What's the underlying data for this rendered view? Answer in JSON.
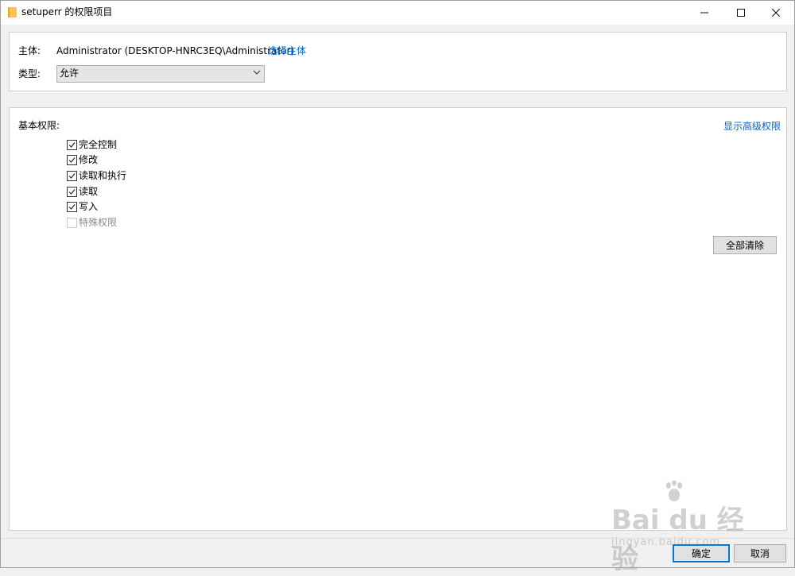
{
  "window": {
    "title": "setuperr 的权限项目",
    "icon": "folder-icon",
    "controls": [
      "minimize-icon",
      "maximize-icon",
      "close-icon"
    ]
  },
  "principal": {
    "label": "主体:",
    "value": "Administrator (DESKTOP-HNRC3EQ\\Administrator)",
    "select_link": "选择主体"
  },
  "type": {
    "label": "类型:",
    "selected": "允许"
  },
  "permissions": {
    "heading": "基本权限:",
    "advanced_link": "显示高级权限",
    "items": [
      {
        "label": "完全控制",
        "checked": true,
        "enabled": true
      },
      {
        "label": "修改",
        "checked": true,
        "enabled": true
      },
      {
        "label": "读取和执行",
        "checked": true,
        "enabled": true
      },
      {
        "label": "读取",
        "checked": true,
        "enabled": true
      },
      {
        "label": "写入",
        "checked": true,
        "enabled": true
      },
      {
        "label": "特殊权限",
        "checked": false,
        "enabled": false
      }
    ],
    "clear_all": "全部清除"
  },
  "footer": {
    "ok": "确定",
    "cancel": "取消"
  },
  "watermark": {
    "main": "Bai du 经验",
    "sub": "jingyan.baidu.com"
  },
  "colors": {
    "link": "#0066cc",
    "accent": "#0078d7"
  }
}
